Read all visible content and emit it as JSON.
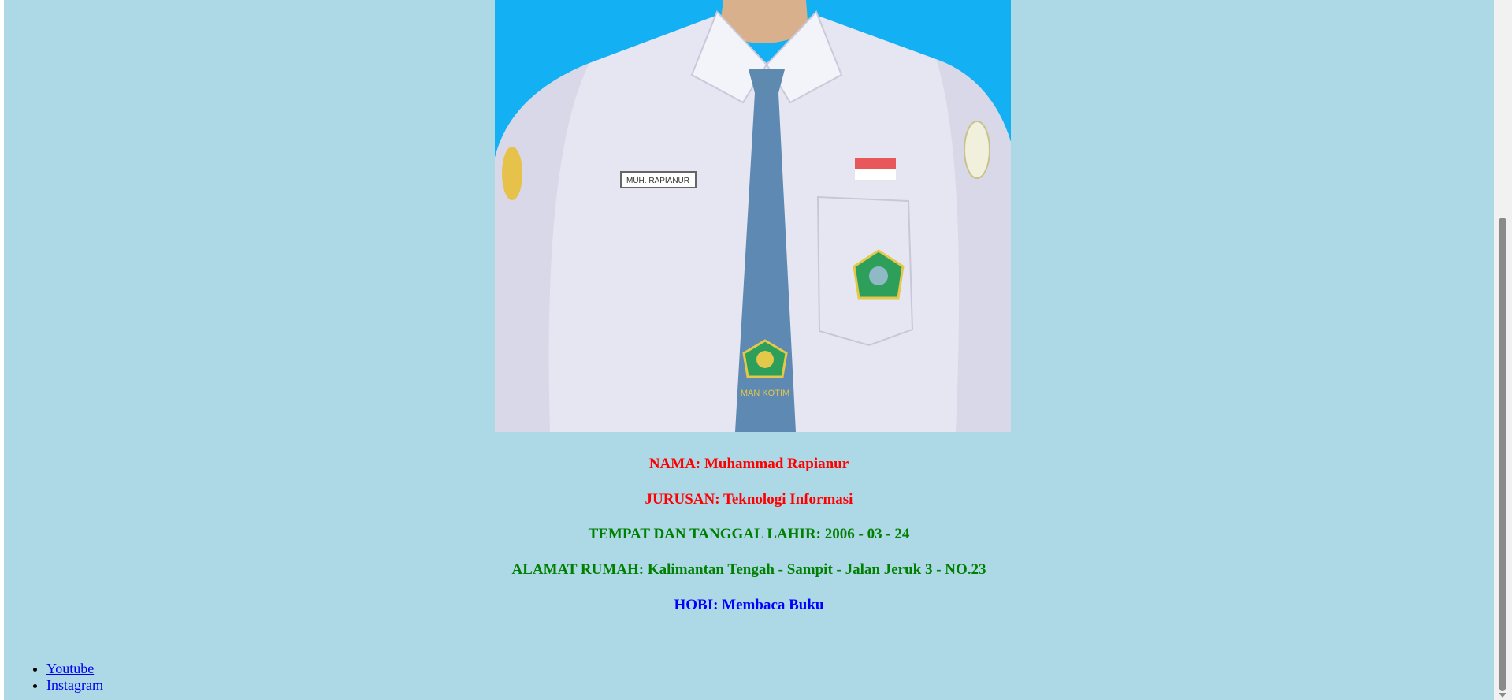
{
  "profile": {
    "name_label": "NAMA: Muhammad Rapianur",
    "major_label": "JURUSAN: Teknologi Informasi",
    "birth_label": "TEMPAT DAN TANGGAL LAHIR: 2006 - 03 - 24",
    "address_label": "ALAMAT RUMAH: Kalimantan Tengah - Sampit - Jalan Jeruk 3 - NO.23",
    "hobby_label": "HOBI: Membaca Buku"
  },
  "photo": {
    "name_tag": "MUH. RAPIANUR",
    "school_tag": "MAN KOTIM"
  },
  "links": [
    "Youtube",
    "Instagram"
  ],
  "colors": {
    "page_background": "#add8e6",
    "photo_background": "#13b0f3",
    "red_text": "#ff0000",
    "green_text": "#008000",
    "blue_text": "#0000ff"
  }
}
